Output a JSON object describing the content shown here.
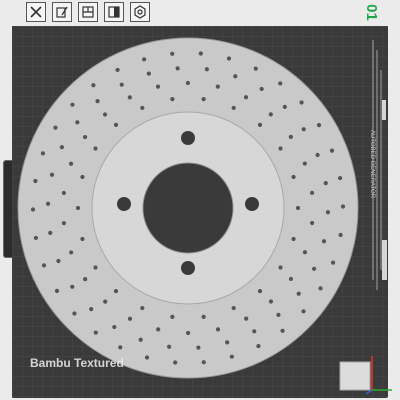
{
  "toolbar": {
    "items": [
      {
        "icon": "close-icon"
      },
      {
        "icon": "edit-icon"
      },
      {
        "icon": "layout-icon"
      },
      {
        "icon": "split-icon"
      },
      {
        "icon": "gear-icon"
      }
    ]
  },
  "plate": {
    "number": "01",
    "label": "Bambu Textured",
    "side_text": "AUTOBED GENERATOR"
  },
  "colors": {
    "plate": "#3a3a3a",
    "grid": "#4a4a4a",
    "disc": "#c9c9c9",
    "accent_green": "#1fa84a"
  }
}
